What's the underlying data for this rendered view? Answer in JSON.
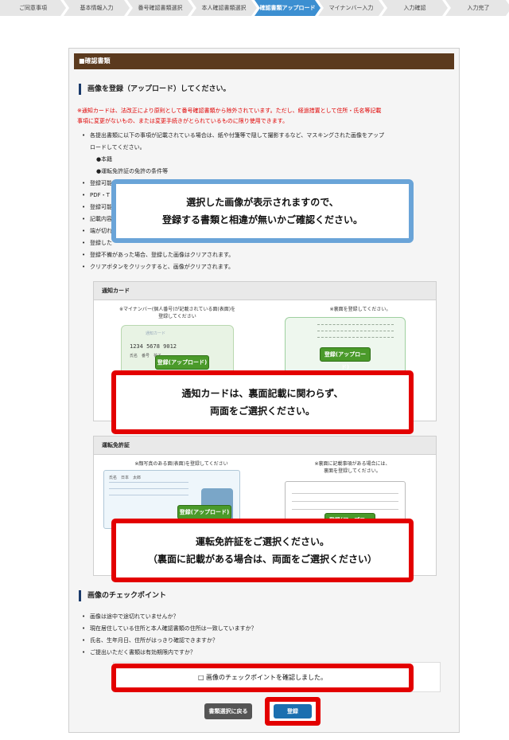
{
  "steps": [
    "ご同意事項",
    "基本情報入力",
    "番号確認書類選択",
    "本人確認書類選択",
    "確認書類アップロード",
    "マイナンバー入力",
    "入力確認",
    "入力完了"
  ],
  "active_step": 4,
  "section_title": "■確認書類",
  "upload_heading": "画像を登録（アップロード）してください。",
  "notice_lines": [
    "※通知カードは、法改正により原則として番号確認書類から除外されています。ただし、経過措置として住所・氏名等記載",
    "事項に変更がないもの、または変更手続きがとられているものに限り使用できます。"
  ],
  "bullets": [
    {
      "text": "各提出書類に以下の事項が記載されている場合は、紙や付箋等で隠して撮影するなど、マスキングされた画像をアップ"
    },
    {
      "text": "ロードしてください。",
      "cls": "cont"
    },
    {
      "text": "●本籍",
      "cls": "sub"
    },
    {
      "text": "●運転免許証の免許の条件等",
      "cls": "sub"
    },
    {
      "text": "登録可能"
    },
    {
      "text": "PDF・T"
    },
    {
      "text": "登録可能"
    },
    {
      "text": "記載内容"
    },
    {
      "text": "端が切れ"
    },
    {
      "text": "登録した"
    },
    {
      "text": "登録不備があった場合、登録した画像はクリアされます。"
    },
    {
      "text": "クリアボタンをクリックすると、画像がクリアされます。"
    }
  ],
  "callouts": {
    "preview": [
      "選択した画像が表示されますので、",
      "登録する書類と相違が無いかご確認ください。"
    ],
    "notify": [
      "通知カードは、裏面記載に関わらず、",
      "両面をご選択ください。"
    ],
    "license": [
      "運転免許証をご選択ください。",
      "（裏面に記載がある場合は、両面をご選択ください）"
    ]
  },
  "notify_card": {
    "title": "通知カード",
    "front_caption": [
      "※マイナンバー(個人番号)が記載されている面(表面)を",
      "登録してください"
    ],
    "back_caption": [
      "※裏面を登録してください。"
    ],
    "card_number": "1234 5678 9012",
    "card_name": "氏名　番号　花子",
    "card_label": "通知カード",
    "upload_label": "登録(アップロード)"
  },
  "license_card": {
    "title": "運転免許証",
    "front_caption": [
      "※顔写真のある面(表面)を登録してください"
    ],
    "back_caption": [
      "※裏面に記載事項がある場合には、",
      "裏面を登録してください。"
    ],
    "card_name": "氏名　日本　太郎",
    "upload_label": "登録(アップロード)"
  },
  "checkpoint": {
    "heading": "画像のチェックポイント",
    "items": [
      "画像は途中で途切れていませんか？",
      "現在居住している住所と本人確認書類の住所は一致していますか？",
      "氏名、生年月日、住所がはっきり確認できますか？",
      "ご提出いただく書類は有効期限内ですか？"
    ],
    "confirm_label": "□ 画像のチェックポイントを確認しました。"
  },
  "buttons": {
    "back": "書類選択に戻る",
    "submit": "登録"
  },
  "colors": {
    "header": "#5b3a1e",
    "active_step": "#3c8fd1",
    "callout_blue": "#6aa4d8",
    "callout_red": "#e30000",
    "upload_green": "#4a9a2a",
    "submit": "#1b6fb0"
  }
}
